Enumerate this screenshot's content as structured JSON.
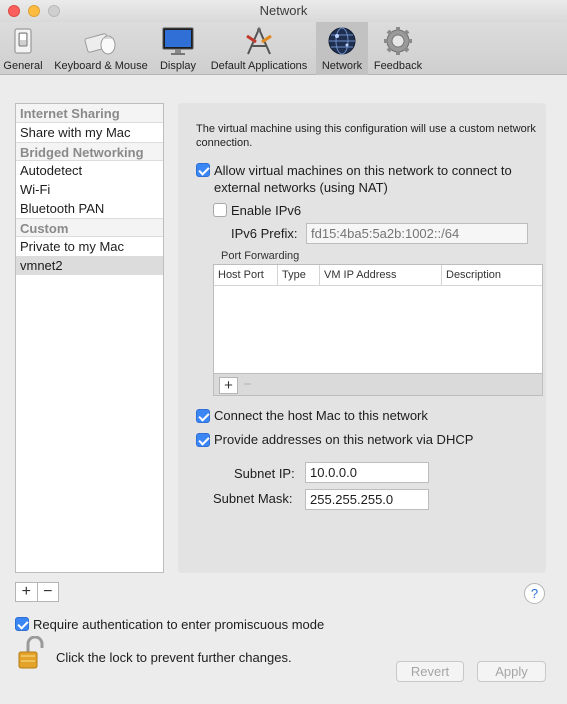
{
  "window": {
    "title": "Network"
  },
  "toolbar": {
    "tabs": [
      {
        "label": "General",
        "icon": "general-switch-icon"
      },
      {
        "label": "Keyboard & Mouse",
        "icon": "keyboard-mouse-icon"
      },
      {
        "label": "Display",
        "icon": "display-monitor-icon"
      },
      {
        "label": "Default Applications",
        "icon": "default-applications-icon"
      },
      {
        "label": "Network",
        "icon": "network-globe-icon",
        "active": true
      },
      {
        "label": "Feedback",
        "icon": "feedback-gear-icon"
      }
    ]
  },
  "sidebar": {
    "sections": [
      {
        "header": "Internet Sharing",
        "items": [
          "Share with my Mac"
        ]
      },
      {
        "header": "Bridged Networking",
        "items": [
          "Autodetect",
          "Wi-Fi",
          "Bluetooth PAN"
        ]
      },
      {
        "header": "Custom",
        "items": [
          "Private to my Mac",
          "vmnet2"
        ]
      }
    ],
    "selected": "vmnet2",
    "add_label": "+",
    "remove_label": "−"
  },
  "panel": {
    "description": "The virtual machine using this configuration will use a custom network connection.",
    "nat": {
      "label": "Allow virtual machines on this network to connect to external networks (using NAT)",
      "checked": true
    },
    "ipv6": {
      "label": "Enable IPv6",
      "checked": false
    },
    "ipv6_prefix": {
      "label": "IPv6 Prefix:",
      "placeholder": "fd15:4ba5:5a2b:1002::/64"
    },
    "port_forwarding": {
      "label": "Port Forwarding",
      "columns": [
        "Host Port",
        "Type",
        "VM IP Address",
        "Description"
      ],
      "add_label": "+",
      "remove_label": "−"
    },
    "connect_host": {
      "label": "Connect the host Mac to this network",
      "checked": true
    },
    "dhcp": {
      "label": "Provide addresses on this network via DHCP",
      "checked": true
    },
    "subnet_ip": {
      "label": "Subnet IP:",
      "value": "10.0.0.0"
    },
    "subnet_mask": {
      "label": "Subnet Mask:",
      "value": "255.255.255.0"
    }
  },
  "footer": {
    "help_label": "?",
    "promiscuous": {
      "label": "Require authentication to enter promiscuous mode",
      "checked": true
    },
    "lock_text": "Click the lock to prevent further changes.",
    "revert_label": "Revert",
    "apply_label": "Apply"
  },
  "colors": {
    "accent": "#3b86f5",
    "selection": "#dcdcdc"
  }
}
